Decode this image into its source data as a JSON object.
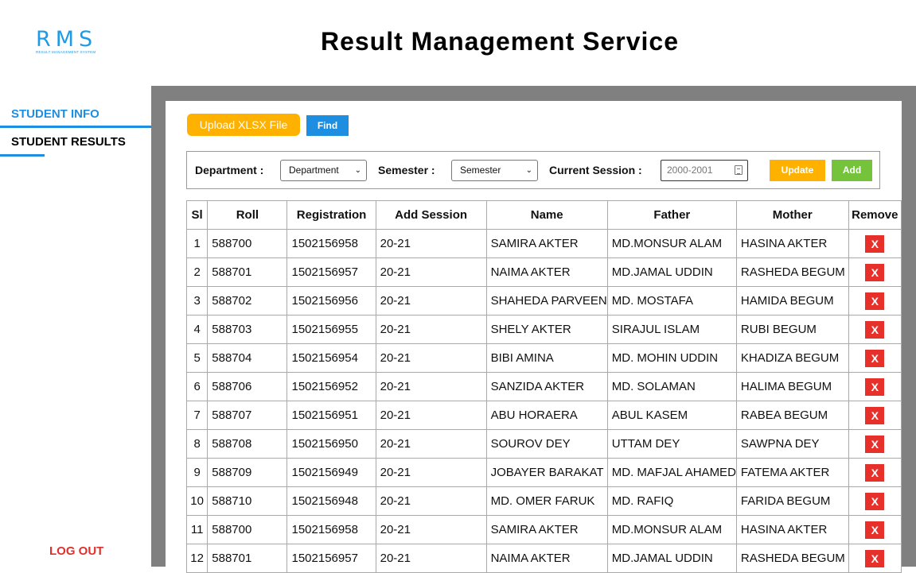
{
  "brand": {
    "logo_main": "RMS",
    "logo_sub": "RESULT MANAGEMENT SYSTEM",
    "accent": "#1e8ee0"
  },
  "header": {
    "title": "Result Management Service"
  },
  "sidebar": {
    "items": [
      {
        "label": "STUDENT INFO"
      },
      {
        "label": "STUDENT RESULTS"
      }
    ],
    "logout": "LOG OUT"
  },
  "toolbar": {
    "upload_label": "Upload XLSX File",
    "find_label": "Find"
  },
  "filters": {
    "department_label": "Department :",
    "department_value": "Department",
    "semester_label": "Semester :",
    "semester_value": "Semester",
    "session_label": "Current Session :",
    "session_placeholder": "2000-2001",
    "update_label": "Update",
    "add_label": "Add"
  },
  "table": {
    "headers": [
      "Sl",
      "Roll",
      "Registration",
      "Add Session",
      "Name",
      "Father",
      "Mother",
      "Remove"
    ],
    "remove_label": "X",
    "rows": [
      [
        "1",
        "588700",
        "1502156958",
        "20-21",
        "SAMIRA AKTER",
        "MD.MONSUR ALAM",
        "HASINA AKTER"
      ],
      [
        "2",
        "588701",
        "1502156957",
        "20-21",
        "NAIMA AKTER",
        "MD.JAMAL UDDIN",
        "RASHEDA BEGUM"
      ],
      [
        "3",
        "588702",
        "1502156956",
        "20-21",
        "SHAHEDA PARVEEN",
        "MD. MOSTAFA",
        "HAMIDA BEGUM"
      ],
      [
        "4",
        "588703",
        "1502156955",
        "20-21",
        "SHELY AKTER",
        "SIRAJUL ISLAM",
        "RUBI BEGUM"
      ],
      [
        "5",
        "588704",
        "1502156954",
        "20-21",
        "BIBI AMINA",
        "MD. MOHIN UDDIN",
        "KHADIZA BEGUM"
      ],
      [
        "6",
        "588706",
        "1502156952",
        "20-21",
        "SANZIDA AKTER",
        "MD. SOLAMAN",
        "HALIMA BEGUM"
      ],
      [
        "7",
        "588707",
        "1502156951",
        "20-21",
        "ABU HORAERA",
        "ABUL KASEM",
        "RABEA BEGUM"
      ],
      [
        "8",
        "588708",
        "1502156950",
        "20-21",
        "SOUROV DEY",
        "UTTAM DEY",
        "SAWPNA DEY"
      ],
      [
        "9",
        "588709",
        "1502156949",
        "20-21",
        "JOBAYER BARAKAT",
        "MD. MAFJAL AHAMED",
        "FATEMA AKTER"
      ],
      [
        "10",
        "588710",
        "1502156948",
        "20-21",
        "MD. OMER FARUK",
        "MD. RAFIQ",
        "FARIDA BEGUM"
      ],
      [
        "11",
        "588700",
        "1502156958",
        "20-21",
        "SAMIRA AKTER",
        "MD.MONSUR ALAM",
        "HASINA AKTER"
      ],
      [
        "12",
        "588701",
        "1502156957",
        "20-21",
        "NAIMA AKTER",
        "MD.JAMAL UDDIN",
        "RASHEDA BEGUM"
      ]
    ]
  }
}
